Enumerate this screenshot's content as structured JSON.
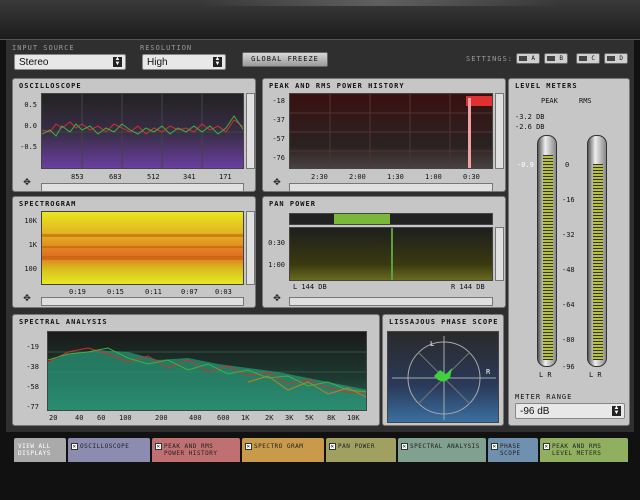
{
  "input_source": {
    "label": "INPUT SOURCE",
    "value": "Stereo"
  },
  "resolution": {
    "label": "RESOLUTION",
    "value": "High"
  },
  "global_freeze": "GLOBAL FREEZE",
  "settings": {
    "label": "SETTINGS:",
    "buttons": [
      "A",
      "B",
      "C",
      "D"
    ]
  },
  "oscilloscope": {
    "title": "OSCILLOSCOPE",
    "y_ticks": [
      "0.5",
      "0.0",
      "-0.5"
    ],
    "x_ticks": [
      "853",
      "683",
      "512",
      "341",
      "171"
    ]
  },
  "power_history": {
    "title": "PEAK AND RMS POWER HISTORY",
    "y_ticks": [
      "-18",
      "-37",
      "-57",
      "-76"
    ],
    "x_ticks": [
      "2:30",
      "2:00",
      "1:30",
      "1:00",
      "0:30"
    ]
  },
  "spectrogram": {
    "title": "SPECTROGRAM",
    "y_ticks": [
      "10K",
      "1K",
      "100"
    ],
    "x_ticks": [
      "0:19",
      "0:15",
      "0:11",
      "0:07",
      "0:03"
    ]
  },
  "pan_power": {
    "title": "PAN POWER",
    "y_ticks": [
      "0:30",
      "1:00"
    ],
    "left_readout": "L 144 DB",
    "right_readout": "R 144 DB"
  },
  "spectral": {
    "title": "SPECTRAL ANALYSIS",
    "y_ticks": [
      "-19",
      "-38",
      "-58",
      "-77"
    ],
    "x_ticks": [
      "20",
      "40",
      "60",
      "100",
      "200",
      "400",
      "600",
      "1K",
      "2K",
      "3K",
      "5K",
      "8K",
      "10K"
    ]
  },
  "lissajous": {
    "title": "LISSAJOUS PHASE SCOPE",
    "markers": [
      "L",
      "R"
    ]
  },
  "level_meters": {
    "title": "LEVEL METERS",
    "peak_label": "PEAK",
    "rms_label": "RMS",
    "peak_value": "-3.2 DB",
    "rms_value": "-2.6 DB",
    "marker": "-0.9",
    "scale": [
      "0",
      "-16",
      "-32",
      "-48",
      "-64",
      "-80",
      "-96"
    ],
    "lr": "L R",
    "peak_level": 0.93,
    "rms_level": 0.89
  },
  "meter_range": {
    "label": "METER RANGE",
    "value": "-96 dB"
  },
  "tabs": [
    "VIEW ALL DISPLAYS",
    "OSCILLOSCOPE",
    "PEAK AND RMS POWER HISTORY",
    "SPECTRO GRAM",
    "PAN POWER",
    "SPECTRAL ANALYSIS",
    "PHASE SCOPE",
    "PEAK AND RMS LEVEL METERS"
  ],
  "colors": {
    "accent_green": "#7ab83a",
    "tab_scope": "#8c8cb0",
    "tab_power": "#c07070",
    "tab_spectro": "#c89a4a",
    "tab_pan": "#a0a060",
    "tab_spectral": "#80a090",
    "tab_phase": "#7090b0",
    "tab_level": "#90b060"
  }
}
